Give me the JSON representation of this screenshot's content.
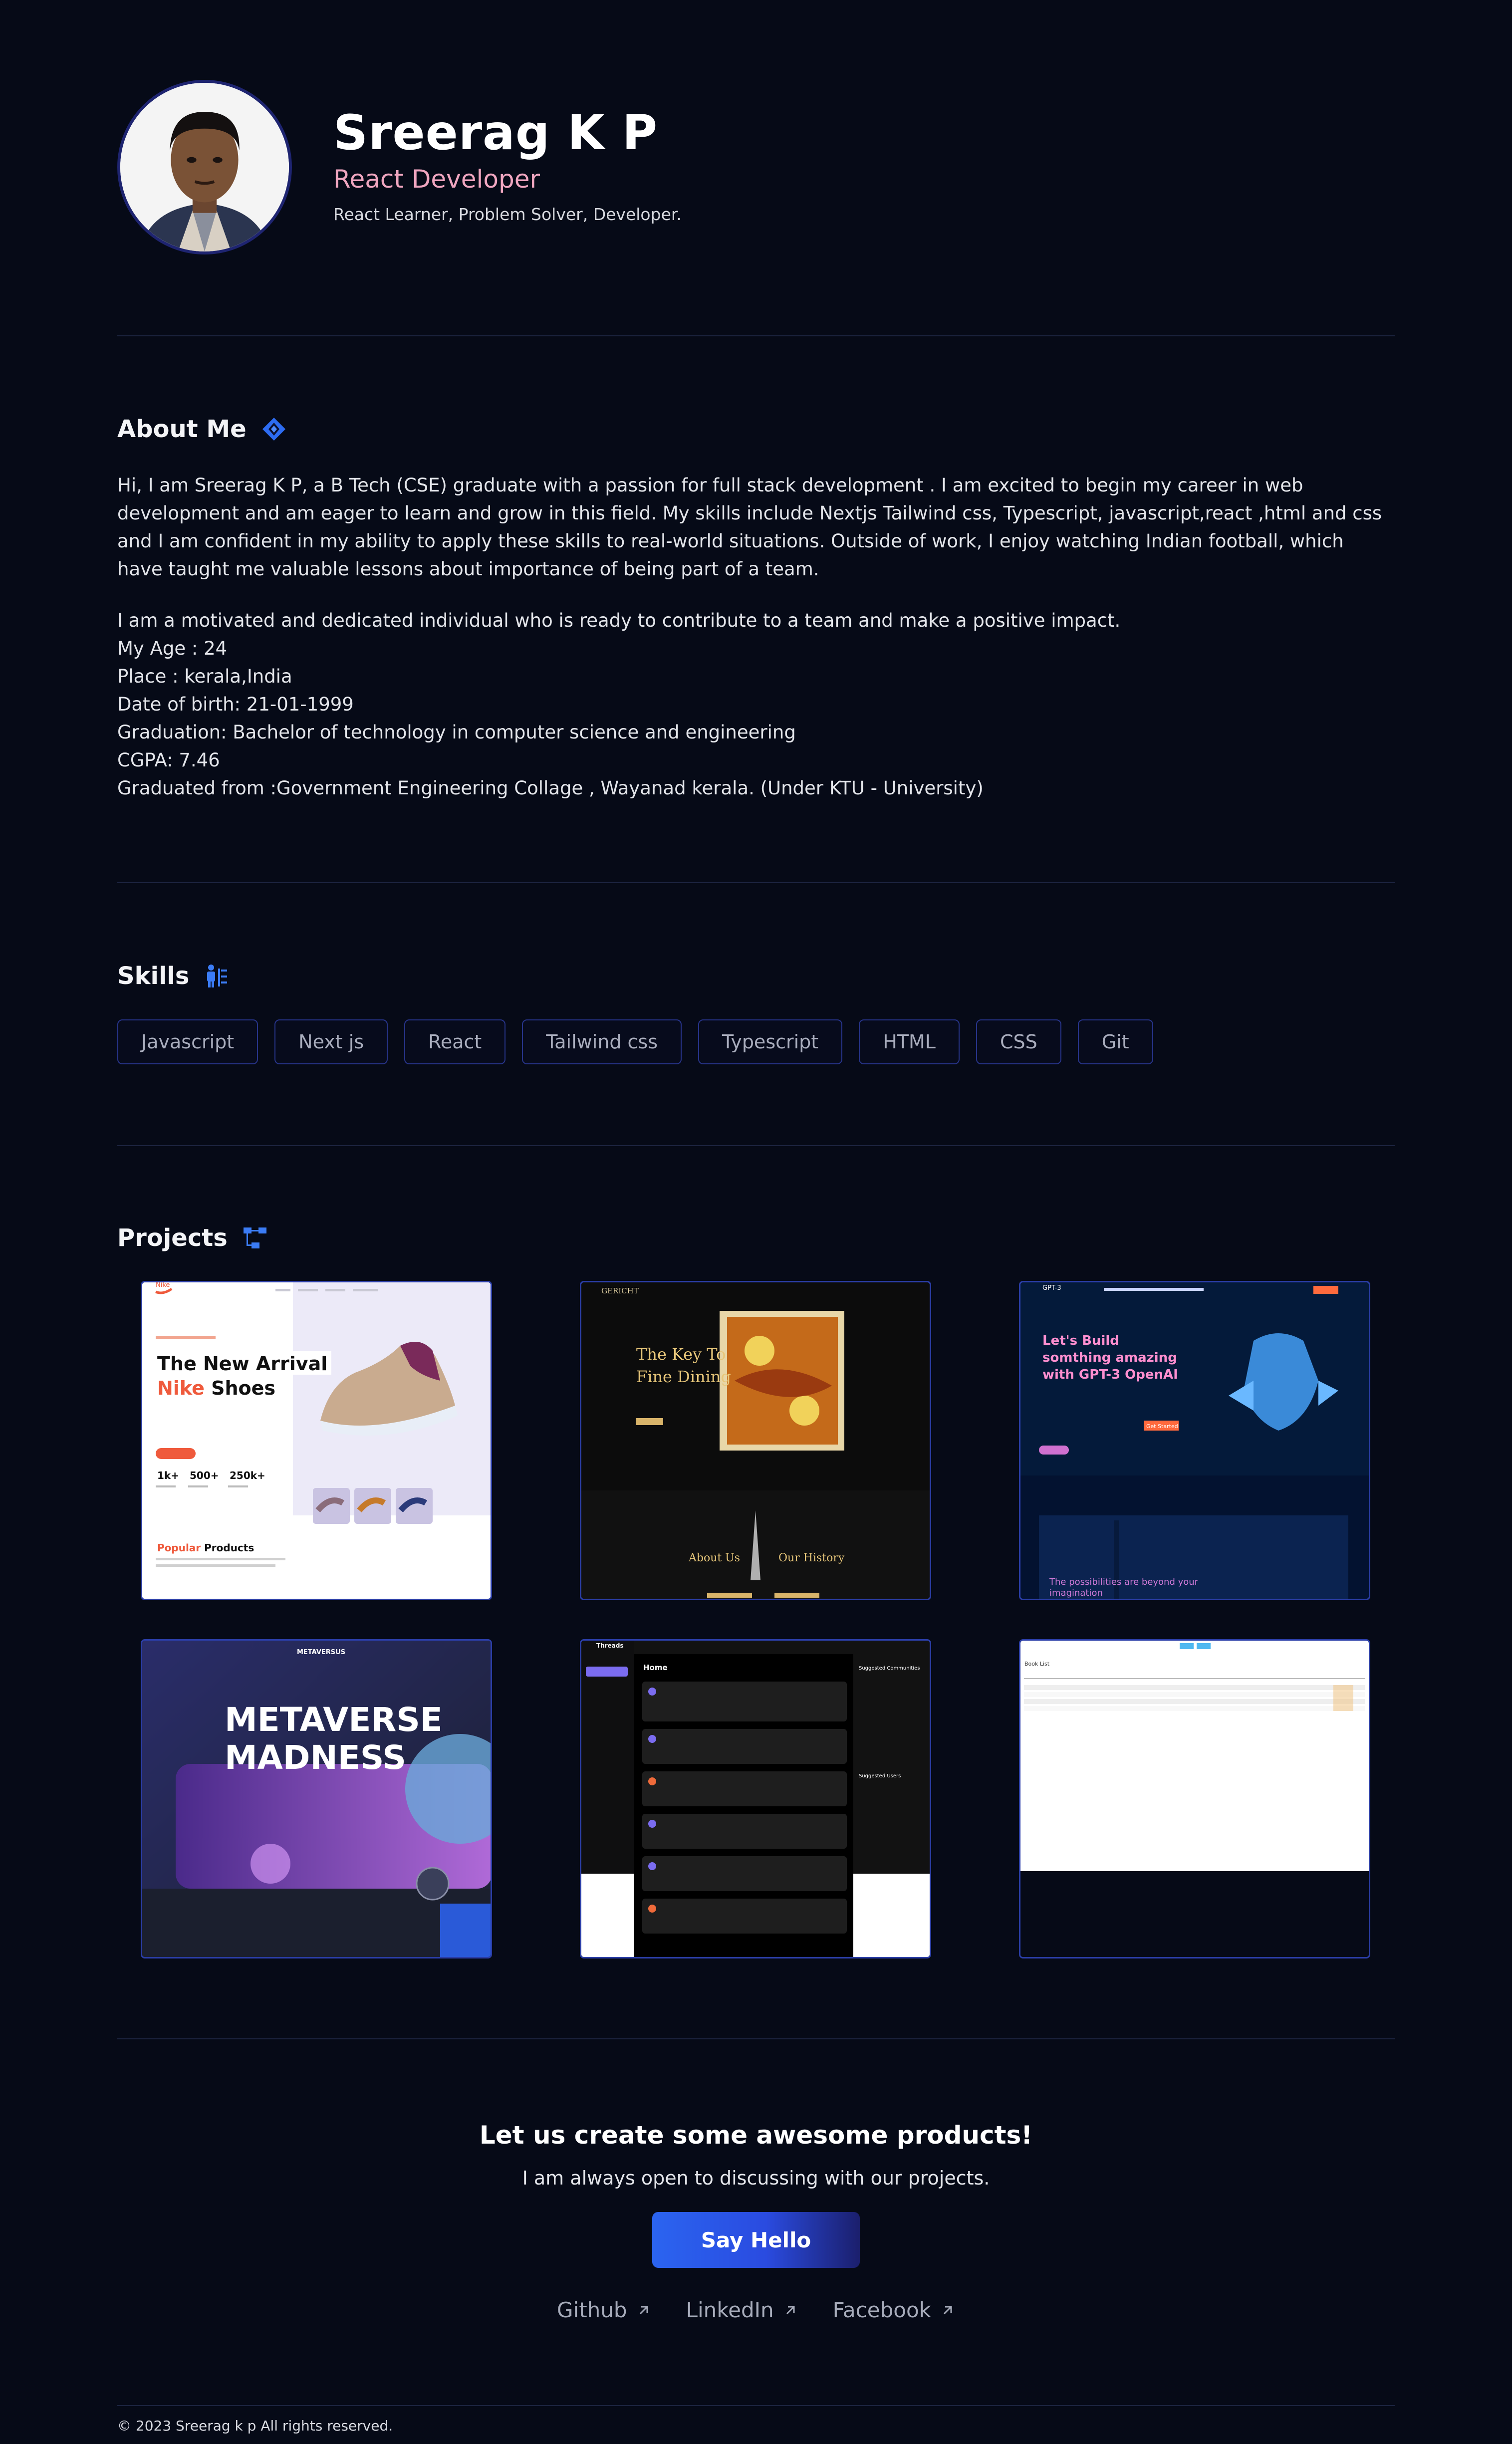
{
  "profile": {
    "name": "Sreerag K P",
    "role": "React Developer",
    "tagline": "React Learner, Problem Solver, Developer."
  },
  "about": {
    "title": "About Me",
    "paragraph1": "Hi, I am Sreerag K P, a B Tech (CSE) graduate with a passion for full stack development . I am excited to begin my career in web development and am eager to learn and grow in this field. My skills include Nextjs Tailwind css, Typescript, javascript,react ,html and css and I am confident in my ability to apply these skills to real-world situations. Outside of work, I enjoy watching Indian football, which have taught me valuable lessons about importance of being part of a team.",
    "lines": [
      "I am a motivated and dedicated individual who is ready to contribute to a team and make a positive impact.",
      "My Age : 24",
      "Place : kerala,India",
      "Date of birth: 21-01-1999",
      "Graduation: Bachelor of technology in computer science and engineering",
      "CGPA: 7.46",
      "Graduated from :Government Engineering Collage , Wayanad kerala. (Under KTU - University)"
    ]
  },
  "skills": {
    "title": "Skills",
    "items": [
      "Javascript",
      "Next js",
      "React",
      "Tailwind css",
      "Typescript",
      "HTML",
      "CSS",
      "Git"
    ]
  },
  "projects": {
    "title": "Projects",
    "nike": {
      "brand": "Nike",
      "headline1": "The New Arrival",
      "headline2a": "Nike",
      "headline2b": " Shoes",
      "stat1": "1k+",
      "stat2": "500+",
      "stat3": "250k+",
      "popular_a": "Popular",
      "popular_b": " Products"
    },
    "gericht": {
      "brand": "GERICHT",
      "headline1": "The Key To",
      "headline2": "Fine Dining",
      "about_a": "About Us",
      "about_b": "Our History"
    },
    "gpt3": {
      "brand": "GPT-3",
      "headline": "Let's Build somthing amazing with GPT-3 OpenAI",
      "button": "Get Started",
      "bottom": "The possibilities are beyond your imagination"
    },
    "metaverse": {
      "brand": "METAVERSUS",
      "line1": "METAVERSE",
      "line2": "MADNESS"
    },
    "threads": {
      "brand": "Threads",
      "home": "Home",
      "suggested1": "Suggested Communities",
      "suggested2": "Suggested Users"
    },
    "booklist": {
      "title": "Book List"
    }
  },
  "cta": {
    "title": "Let us create some awesome products!",
    "subtitle": "I am always open to discussing with our projects.",
    "button": "Say Hello"
  },
  "links": [
    "Github",
    "LinkedIn",
    "Facebook"
  ],
  "footer": "© 2023 Sreerag k p All rights reserved.",
  "colors": {
    "background": "#060a17",
    "accent": "#2b64f0",
    "role": "#f0a6c0",
    "chip_border": "#27348a"
  }
}
